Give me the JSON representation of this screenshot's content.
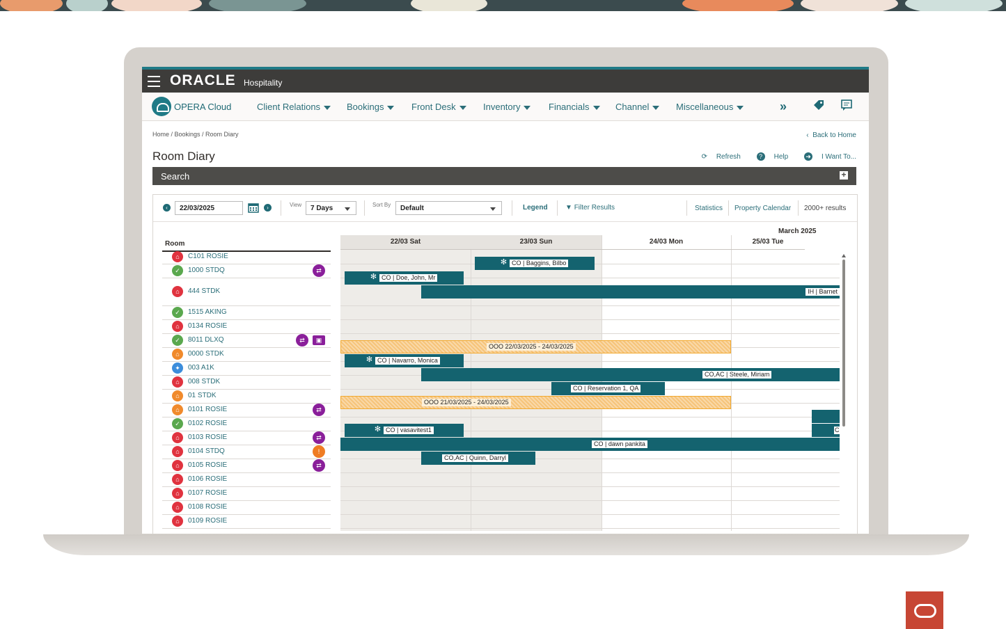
{
  "colors": {
    "accent": "#1f7a86",
    "booking": "#14636f",
    "ooo": "#f6c47a",
    "brand_red": "#c74634"
  },
  "app": {
    "brand": "ORACLE",
    "brand_suffix": "Hospitality",
    "product": "OPERA Cloud"
  },
  "nav": {
    "items": [
      "Client Relations",
      "Bookings",
      "Front Desk",
      "Inventory",
      "Financials",
      "Channel",
      "Miscellaneous"
    ],
    "more_icon": "double-chevron-right-icon",
    "icons": [
      "tag-icon",
      "messages-icon"
    ]
  },
  "breadcrumb": "Home / Bookings / Room Diary",
  "back_link": "Back to Home",
  "page": {
    "title": "Room Diary",
    "refresh": "Refresh",
    "help": "Help",
    "iwantto": "I Want To..."
  },
  "search": {
    "label": "Search"
  },
  "filters": {
    "date": "22/03/2025",
    "view_label": "View",
    "view_value": "7 Days",
    "sort_label": "Sort By",
    "sort_value": "Default",
    "legend": "Legend",
    "filter_results": "Filter Results",
    "statistics": "Statistics",
    "property_calendar": "Property Calendar",
    "results": "2000+ results"
  },
  "grid": {
    "room_header": "Room",
    "month": "March 2025",
    "days": [
      "22/03 Sat",
      "23/03 Sun",
      "24/03 Mon",
      "25/03 Tue"
    ],
    "rooms": [
      {
        "name": "C101 ROSIE",
        "status": "dirty"
      },
      {
        "name": "1000 STDQ",
        "status": "clean",
        "icons": [
          "connecting"
        ]
      },
      {
        "name": "444 STDK",
        "status": "dirty"
      },
      {
        "name": "1515 AKING",
        "status": "clean"
      },
      {
        "name": "0134 ROSIE",
        "status": "dirty"
      },
      {
        "name": "8011 DLXQ",
        "status": "clean",
        "icons": [
          "connecting",
          "component"
        ]
      },
      {
        "name": "0000 STDK",
        "status": "pickup"
      },
      {
        "name": "003 A1K",
        "status": "inspected"
      },
      {
        "name": "008 STDK",
        "status": "dirty"
      },
      {
        "name": "01 STDK",
        "status": "pickup"
      },
      {
        "name": "0101 ROSIE",
        "status": "pickup",
        "icons": [
          "connecting"
        ]
      },
      {
        "name": "0102 ROSIE",
        "status": "clean"
      },
      {
        "name": "0103 ROSIE",
        "status": "dirty",
        "icons": [
          "connecting"
        ]
      },
      {
        "name": "0104 STDQ",
        "status": "dirty",
        "icons": [
          "alert"
        ]
      },
      {
        "name": "0105 ROSIE",
        "status": "dirty",
        "icons": [
          "connecting"
        ]
      },
      {
        "name": "0106 ROSIE",
        "status": "dirty"
      },
      {
        "name": "0107 ROSIE",
        "status": "dirty"
      },
      {
        "name": "0108 ROSIE",
        "status": "dirty"
      },
      {
        "name": "0109 ROSIE",
        "status": "dirty"
      }
    ],
    "bookings": [
      {
        "label": "CO | Baggins, Bilbo",
        "gear": true
      },
      {
        "label": "CO | Doe, John, Mr",
        "gear": true
      },
      {
        "label": "IH | Barnet",
        "gear": false
      },
      {
        "label": "OOO 22/03/2025 - 24/03/2025",
        "ooo": true
      },
      {
        "label": "CO | Navarro, Monica",
        "gear": true
      },
      {
        "label": "CO,AC | Steele, Miriam",
        "gear": false
      },
      {
        "label": "CO | Reservation 1, QA",
        "gear": false
      },
      {
        "label": "OOO 21/03/2025 - 24/03/2025",
        "ooo": true
      },
      {
        "label": "CO | vasavitest1",
        "gear": true
      },
      {
        "label": "C",
        "gear": false
      },
      {
        "label": "CO | dawn pankita",
        "gear": false
      },
      {
        "label": "CO,AC | Quinn, Darryl",
        "gear": false
      }
    ]
  }
}
